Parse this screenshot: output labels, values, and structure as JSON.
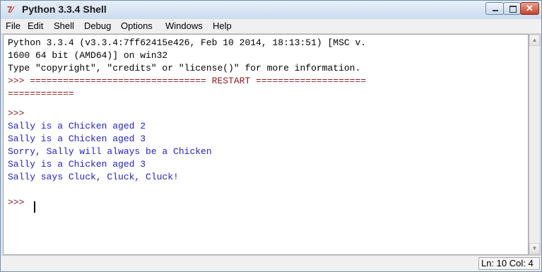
{
  "window": {
    "icon_text": "7⁄",
    "title": "Python 3.3.4 Shell",
    "close_glyph": "✕"
  },
  "menu": [
    "File",
    "Edit",
    "Shell",
    "Debug",
    "Options",
    "Windows",
    "Help"
  ],
  "editor": {
    "lines": [
      "Python 3.3.4 (v3.3.4:7ff62415e426, Feb 10 2014, 18:13:51) [MSC v.",
      "1600 64 bit (AMD64)] on win32",
      "Type \"copyright\", \"credits\" or \"license()\" for more information.",
      ">>> ================================ RESTART ====================",
      "============",
      ">>>",
      "Sally is a Chicken aged 2",
      "Sally is a Chicken aged 3",
      "Sorry, Sally will always be a Chicken",
      "Sally is a Chicken aged 3",
      "Sally says Cluck, Cluck, Cluck!",
      ">>> "
    ]
  },
  "status": {
    "position": "Ln: 10 Col: 4"
  },
  "scroll": {
    "up": "▲",
    "down": "▼"
  },
  "colors": {
    "output": "#1f1fd6",
    "prompt": "#8b1a1a",
    "text": "#000000"
  }
}
